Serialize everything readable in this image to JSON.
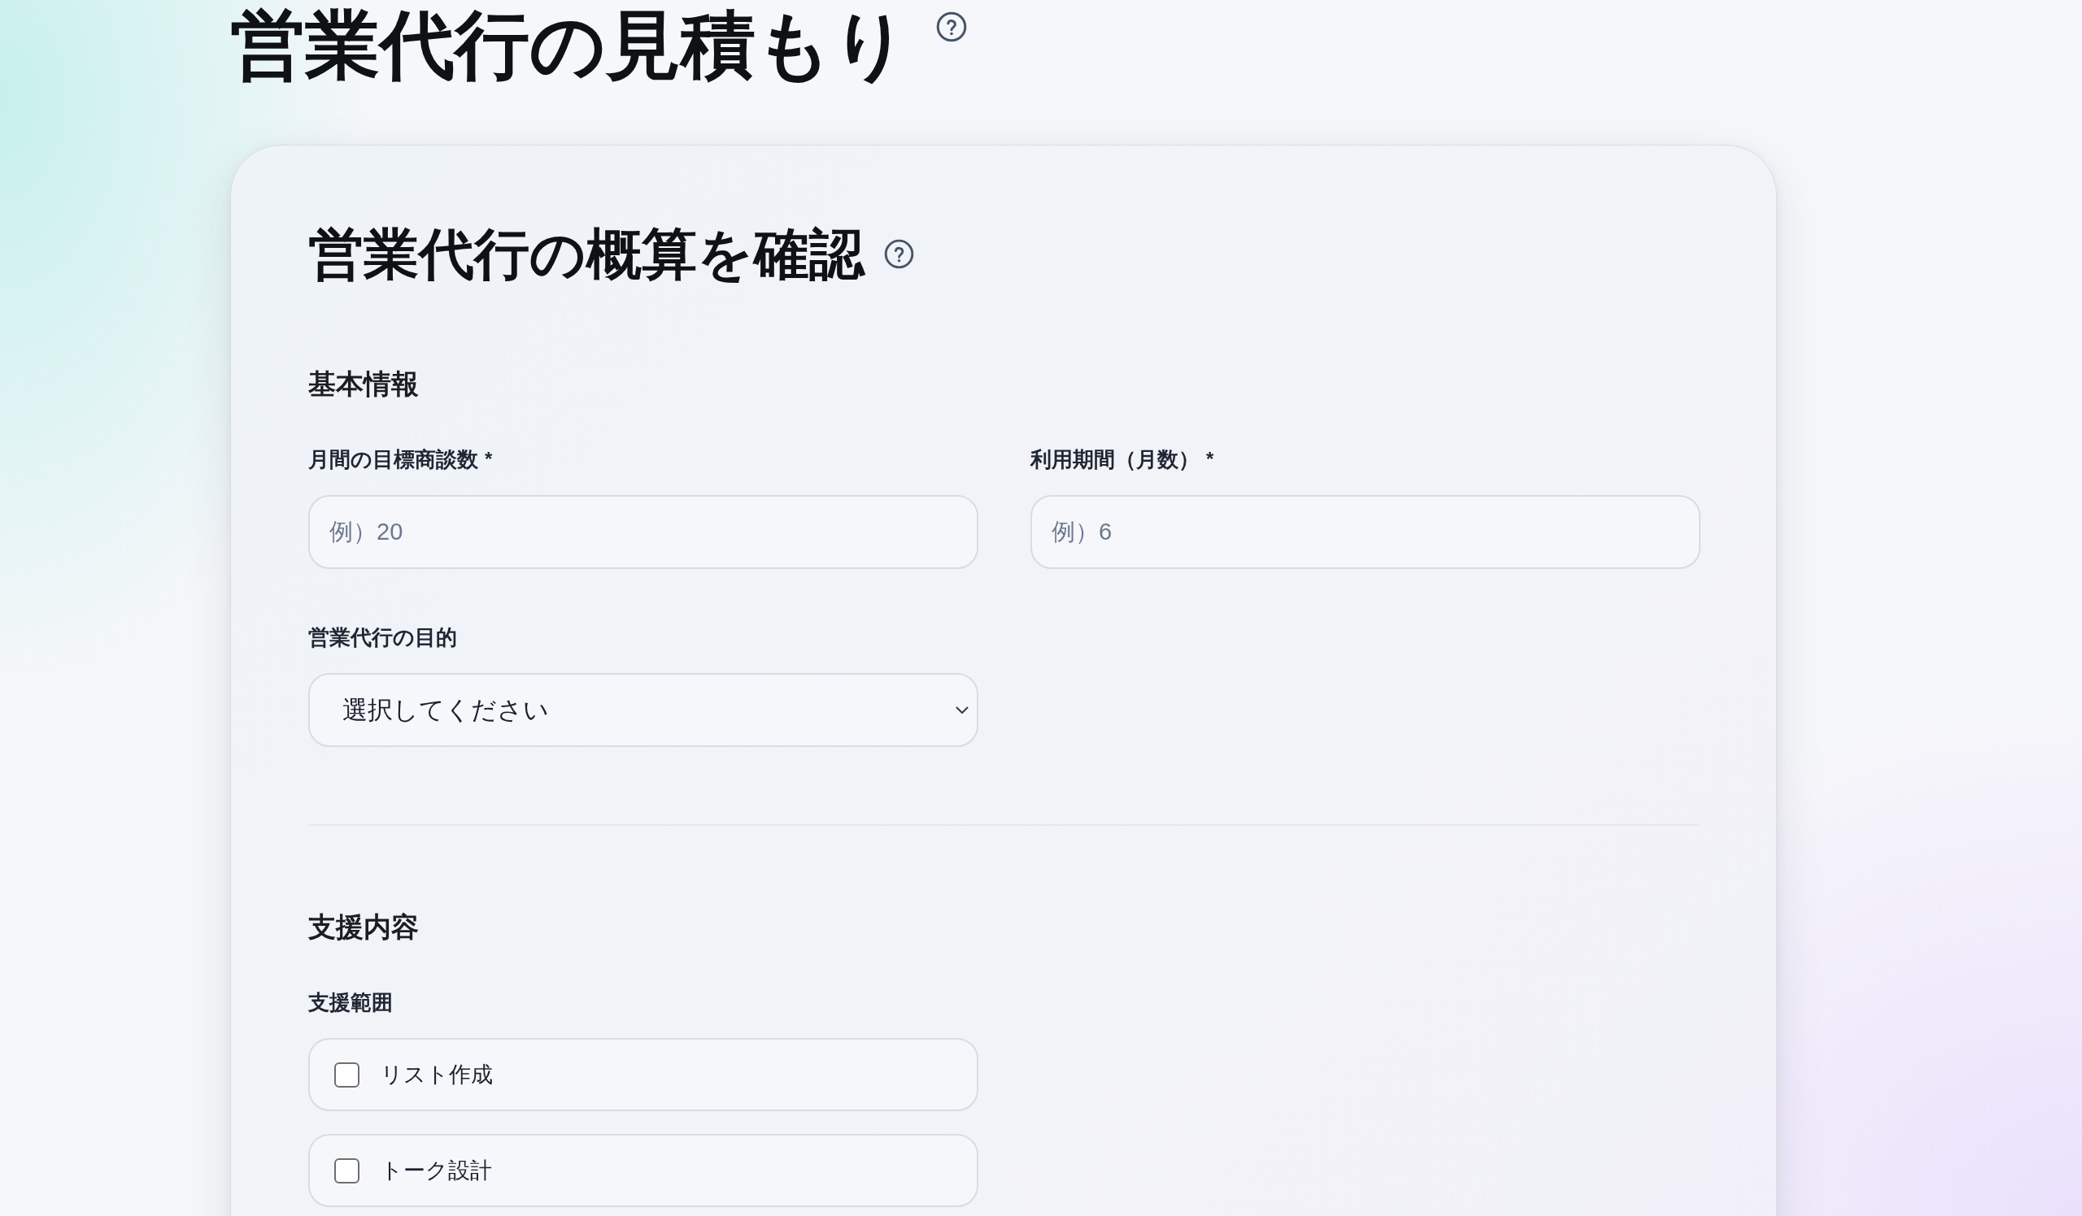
{
  "page_title": "営業代行の見積もり",
  "card": {
    "title": "営業代行の概算を確認",
    "sections": [
      {
        "title": "基本情報",
        "fields": [
          {
            "kind": "text",
            "label": "月間の目標商談数",
            "required_mark": "*",
            "placeholder": "例）20"
          },
          {
            "kind": "text",
            "label": "利用期間（月数）",
            "required_mark": "*",
            "placeholder": "例）6"
          },
          {
            "kind": "select",
            "label": "営業代行の目的",
            "value": "選択してください"
          }
        ]
      },
      {
        "title": "支援内容",
        "fields": [
          {
            "kind": "checkbox_group",
            "label": "支援範囲",
            "options": [
              {
                "label": "リスト作成",
                "checked": false
              },
              {
                "label": "トーク設計",
                "checked": false
              }
            ]
          }
        ]
      }
    ]
  }
}
